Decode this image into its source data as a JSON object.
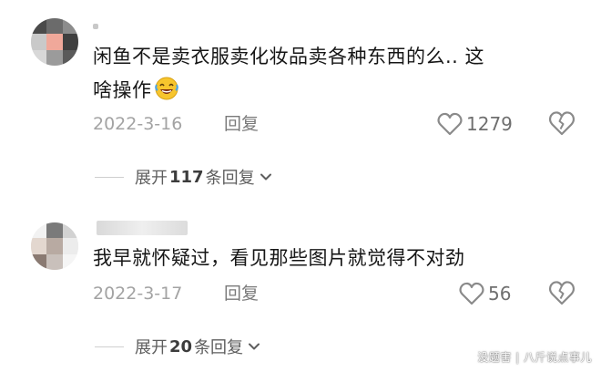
{
  "comments": [
    {
      "text_line1": "闲鱼不是卖衣服卖化妆品卖各种东西的么.. 这",
      "text_line2": "啥操作",
      "emoji": "laugh-cry-emoji",
      "date": "2022-3-16",
      "reply_label": "回复",
      "like_count": "1279",
      "expand": {
        "prefix": "展开",
        "count": "117",
        "suffix": "条回复"
      }
    },
    {
      "text_line1": "我早就怀疑过，看见那些图片就觉得不对劲",
      "date": "2022-3-17",
      "reply_label": "回复",
      "like_count": "56",
      "expand": {
        "prefix": "展开",
        "count": "20",
        "suffix": "条回复"
      }
    }
  ],
  "watermark": "没题害 | 八斤说点事儿",
  "icons": {
    "like": "heart-outline-icon",
    "dislike": "broken-heart-outline-icon",
    "expand": "chevron-down-icon"
  }
}
